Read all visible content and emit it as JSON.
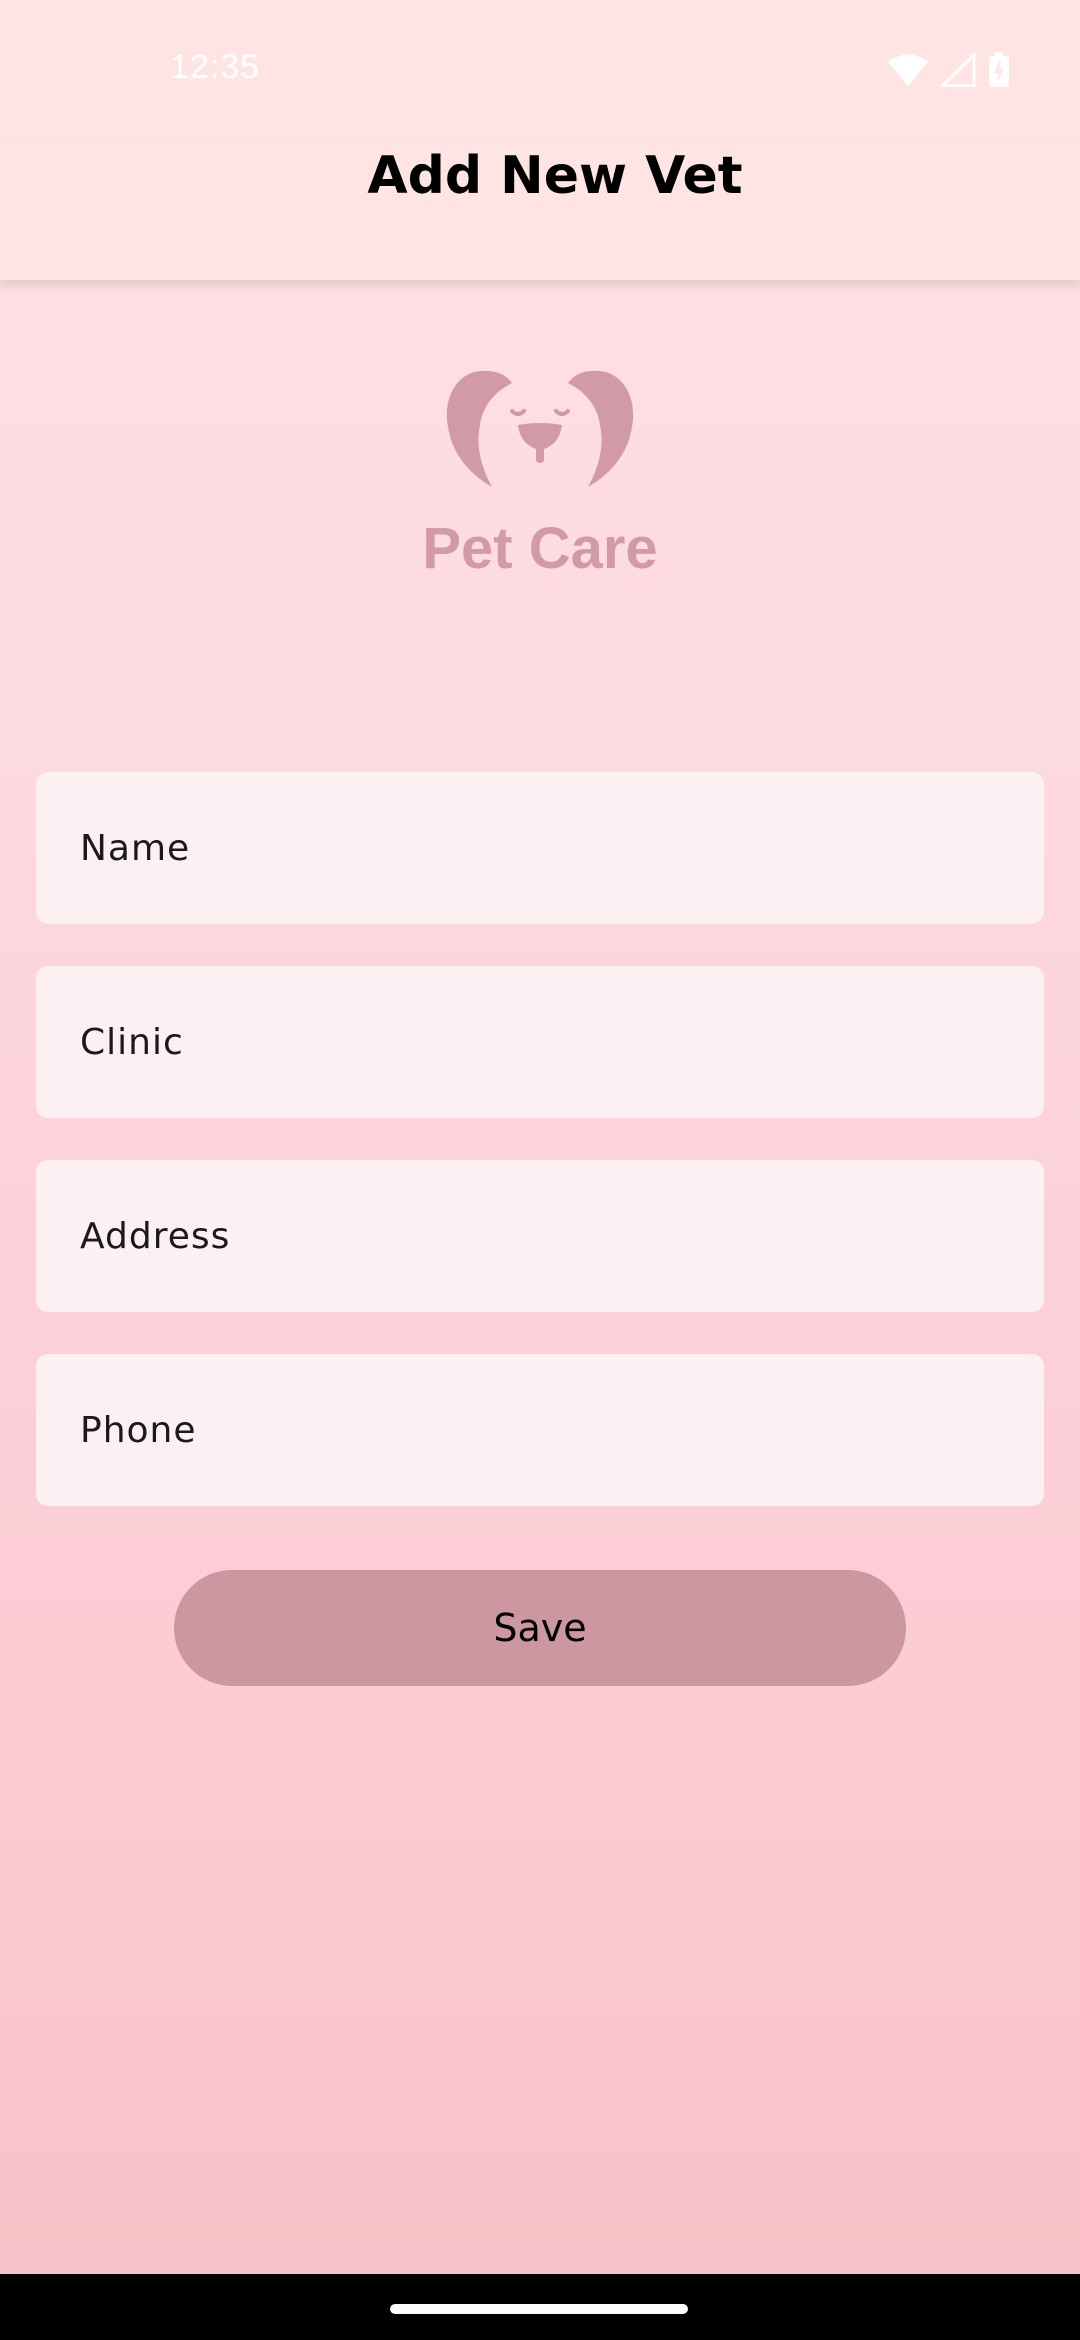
{
  "status_bar": {
    "time": "12:35",
    "icons": [
      "wifi-icon",
      "cell-signal-icon",
      "battery-charging-icon"
    ]
  },
  "app_bar": {
    "title": "Add New Vet"
  },
  "logo": {
    "text": "Pet Care",
    "icon": "dog-face-icon",
    "color": "#d29aa7"
  },
  "form": {
    "name_placeholder": "Name",
    "clinic_placeholder": "Clinic",
    "address_placeholder": "Address",
    "phone_placeholder": "Phone"
  },
  "actions": {
    "save_label": "Save"
  },
  "colors": {
    "accent": "#cc97a1",
    "field_bg": "#fdf0f2",
    "app_bar_bg": "#fee5e3"
  }
}
